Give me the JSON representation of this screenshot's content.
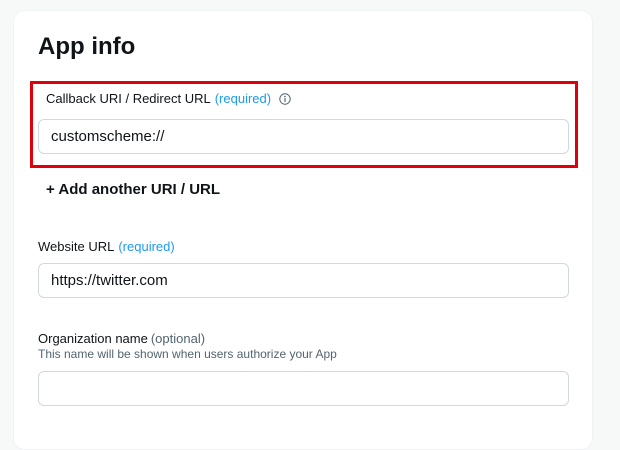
{
  "app_info": {
    "title": "App info",
    "callback": {
      "label": "Callback URI / Redirect URL",
      "required_tag": "(required)",
      "info_icon": "info-icon",
      "value": "customscheme://"
    },
    "add_link": "+ Add another URI / URL",
    "website": {
      "label": "Website URL",
      "required_tag": "(required)",
      "value": "https://twitter.com"
    },
    "organization": {
      "label": "Organization name",
      "optional_tag": "(optional)",
      "helper": "This name will be shown when users authorize your App",
      "value": ""
    }
  },
  "colors": {
    "highlight": "#e0000a",
    "accent": "#1d9bf0"
  }
}
